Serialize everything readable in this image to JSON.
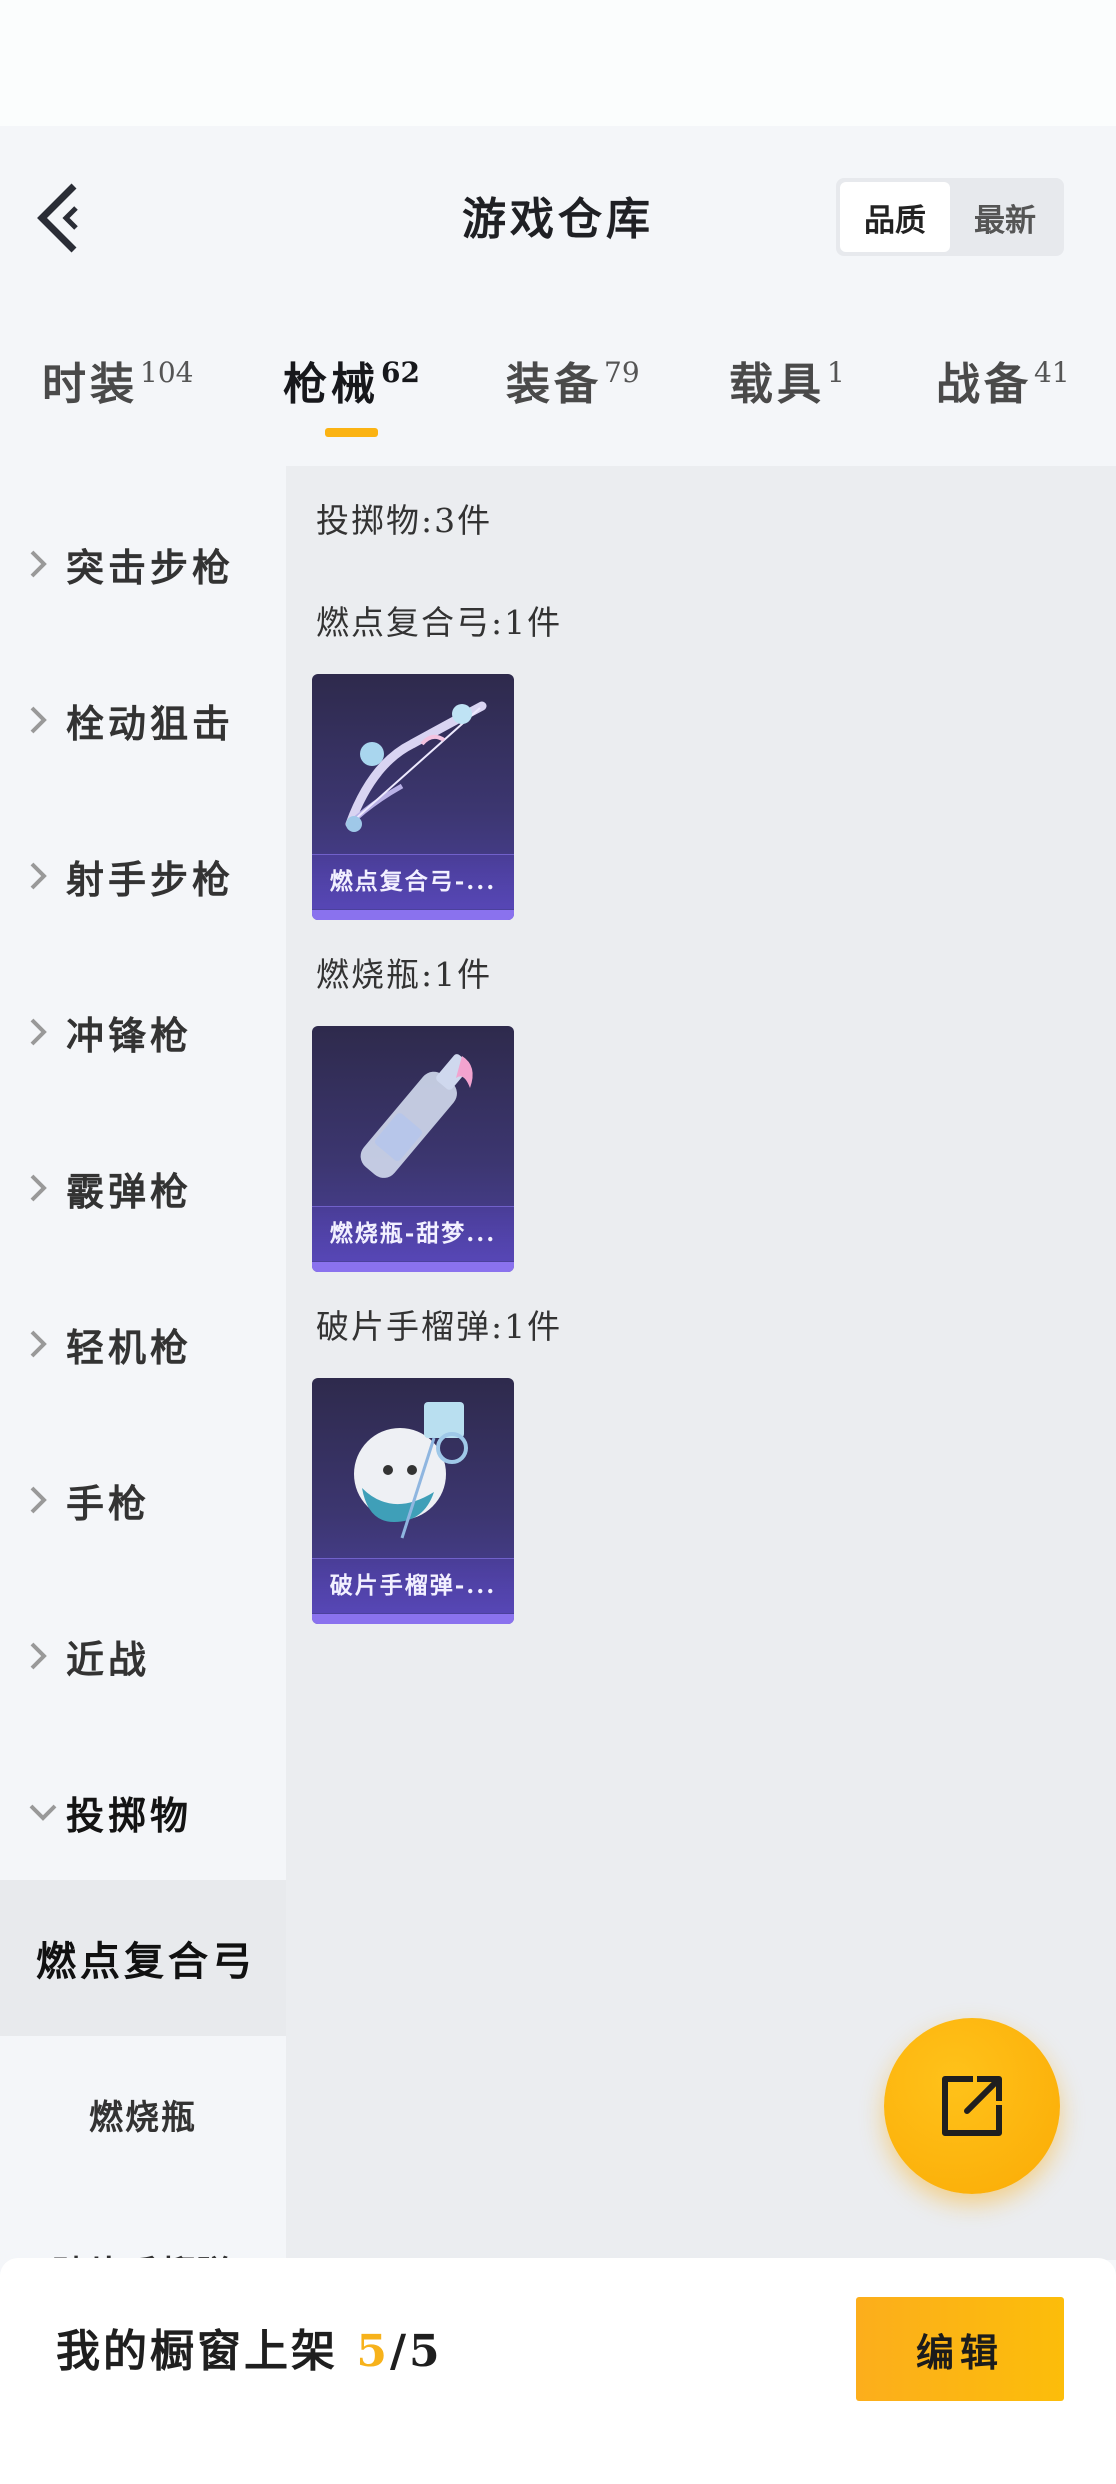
{
  "header": {
    "title": "游戏仓库",
    "sort": {
      "options": [
        "品质",
        "最新"
      ],
      "active": "品质"
    }
  },
  "tabs": [
    {
      "label": "时装",
      "count": "104"
    },
    {
      "label": "枪械",
      "count": "62"
    },
    {
      "label": "装备",
      "count": "79"
    },
    {
      "label": "载具",
      "count": "1"
    },
    {
      "label": "战备",
      "count": "41"
    }
  ],
  "active_tab": "枪械",
  "sidebar": {
    "categories": [
      "突击步枪",
      "栓动狙击",
      "射手步枪",
      "冲锋枪",
      "霰弹枪",
      "轻机枪",
      "手枪",
      "近战",
      "投掷物"
    ],
    "expanded": "投掷物",
    "subitems": [
      "燃点复合弓",
      "燃烧瓶",
      "破片手榴弹"
    ],
    "selected_subitem": "燃点复合弓"
  },
  "content": {
    "summary": "投掷物:3件",
    "groups": [
      {
        "header": "燃点复合弓:1件",
        "card_name": "燃点复合弓-...",
        "icon": "compound-bow-icon"
      },
      {
        "header": "燃烧瓶:1件",
        "card_name": "燃烧瓶-甜梦...",
        "icon": "molotov-bottle-icon"
      },
      {
        "header": "破片手榴弹:1件",
        "card_name": "破片手榴弹-...",
        "icon": "frag-grenade-icon"
      }
    ]
  },
  "bottom": {
    "showcase_label": "我的橱窗上架 ",
    "showcase_current": "5",
    "showcase_total": "/5",
    "edit_label": "编辑"
  },
  "colors": {
    "accent": "#fbb313",
    "card_bg": "#3c3670"
  }
}
